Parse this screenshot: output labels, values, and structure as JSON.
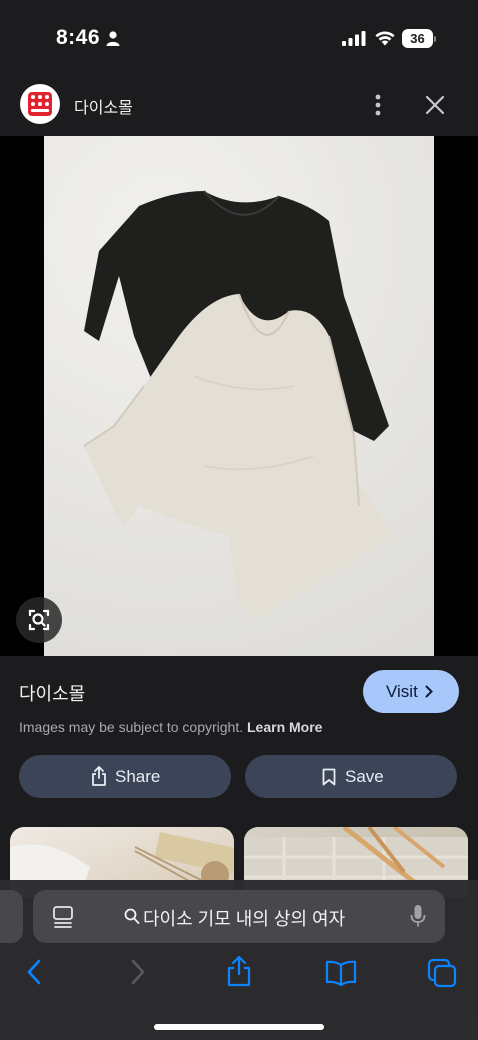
{
  "status_bar": {
    "time": "8:46",
    "battery": "36"
  },
  "header": {
    "site_name": "다이소몰",
    "logo_icon": "daiso-logo-icon",
    "more_icon": "more-vertical-icon",
    "close_icon": "close-icon"
  },
  "image": {
    "description_icon": "lens-search-icon"
  },
  "info": {
    "title": "다이소몰",
    "visit_label": "Visit",
    "copyright_text": "Images may be subject to copyright.",
    "learn_more": "Learn More",
    "share_label": "Share",
    "save_label": "Save"
  },
  "safari": {
    "address_text": "다이소 기모 내의 상의 여자",
    "back_icon": "chevron-left-icon",
    "forward_icon": "chevron-right-icon",
    "share_icon": "share-icon",
    "bookmarks_icon": "book-icon",
    "tabs_icon": "tabs-icon"
  },
  "colors": {
    "background": "#1c1c1e",
    "visit_button": "#a8c7fa",
    "action_button": "#3b4557",
    "address_bar": "#48484c",
    "link_blue": "#0a84ff"
  }
}
